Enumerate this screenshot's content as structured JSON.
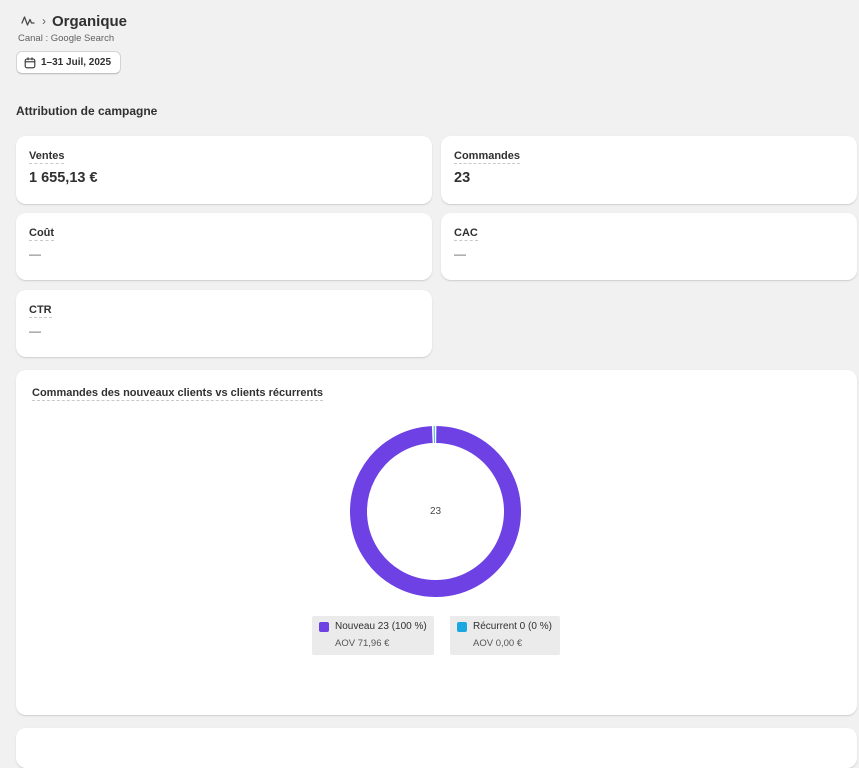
{
  "header": {
    "breadcrumb_icon": "channel-activity-icon",
    "separator": "›",
    "title": "Organique",
    "subtitle": "Canal : Google Search"
  },
  "date_filter": {
    "icon": "calendar-icon",
    "label": "1–31 Juil, 2025"
  },
  "section": {
    "title": "Attribution de campagne"
  },
  "metrics": [
    {
      "label": "Ventes",
      "value": "1 655,13 €"
    },
    {
      "label": "Commandes",
      "value": "23"
    },
    {
      "label": "Coût",
      "value": "—"
    },
    {
      "label": "CAC",
      "value": "—"
    },
    {
      "label": "CTR",
      "value": "—"
    }
  ],
  "chart_data": {
    "type": "pie",
    "title": "Commandes des nouveaux clients vs clients récurrents",
    "center_label": "23",
    "series": [
      {
        "name": "Nouveau",
        "value": 23,
        "label": "Nouveau 23 (100 %)",
        "sub_label": "AOV 71,96 €",
        "color": "#6d41e4"
      },
      {
        "name": "Récurrent",
        "value": 0,
        "label": "Récurrent 0 (0 %)",
        "sub_label": "AOV 0,00 €",
        "color": "#1ba8e0"
      }
    ]
  },
  "colors": {
    "background": "#f1f1f1",
    "card": "#ffffff",
    "new_customers": "#6d41e4",
    "returning_customers": "#1ba8e0"
  }
}
